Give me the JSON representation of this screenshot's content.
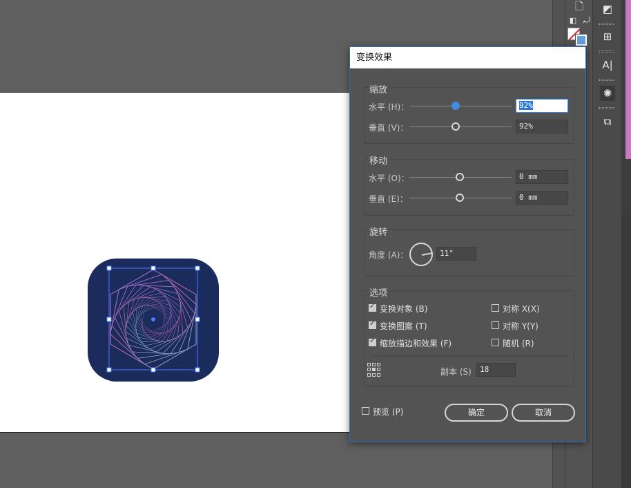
{
  "dialog": {
    "title": "变换效果",
    "scale": {
      "label": "缩放",
      "horizontal_label": "水平 (H)：",
      "horizontal_value": "92%",
      "vertical_label": "垂直 (V)：",
      "vertical_value": "92%"
    },
    "move": {
      "label": "移动",
      "horizontal_label": "水平 (O)：",
      "horizontal_value": "0 mm",
      "vertical_label": "垂直 (E)：",
      "vertical_value": "0 mm"
    },
    "rotate": {
      "label": "旋转",
      "angle_label": "角度 (A)：",
      "angle_value": "11°"
    },
    "options": {
      "label": "选项",
      "transform_objects": "变换对象 (B)",
      "transform_patterns": "变换图案 (T)",
      "scale_strokes": "缩放描边和效果 (F)",
      "reflect_x": "对称 X(X)",
      "reflect_y": "对称 Y(Y)",
      "random": "随机 (R)",
      "copies_label": "副本 (S)",
      "copies_value": "18"
    },
    "preview_label": "预览 (P)",
    "ok_label": "确定",
    "cancel_label": "取消"
  },
  "colors": {
    "accent": "#3f8de0",
    "icon_background": "#1b2b5c",
    "dialog_border": "#2f6fb5"
  },
  "icons": [
    "rotate-arrow-icon",
    "type-tool-icon",
    "transform-icon",
    "appearance-icon",
    "links-icon",
    "reference-point-icon"
  ]
}
